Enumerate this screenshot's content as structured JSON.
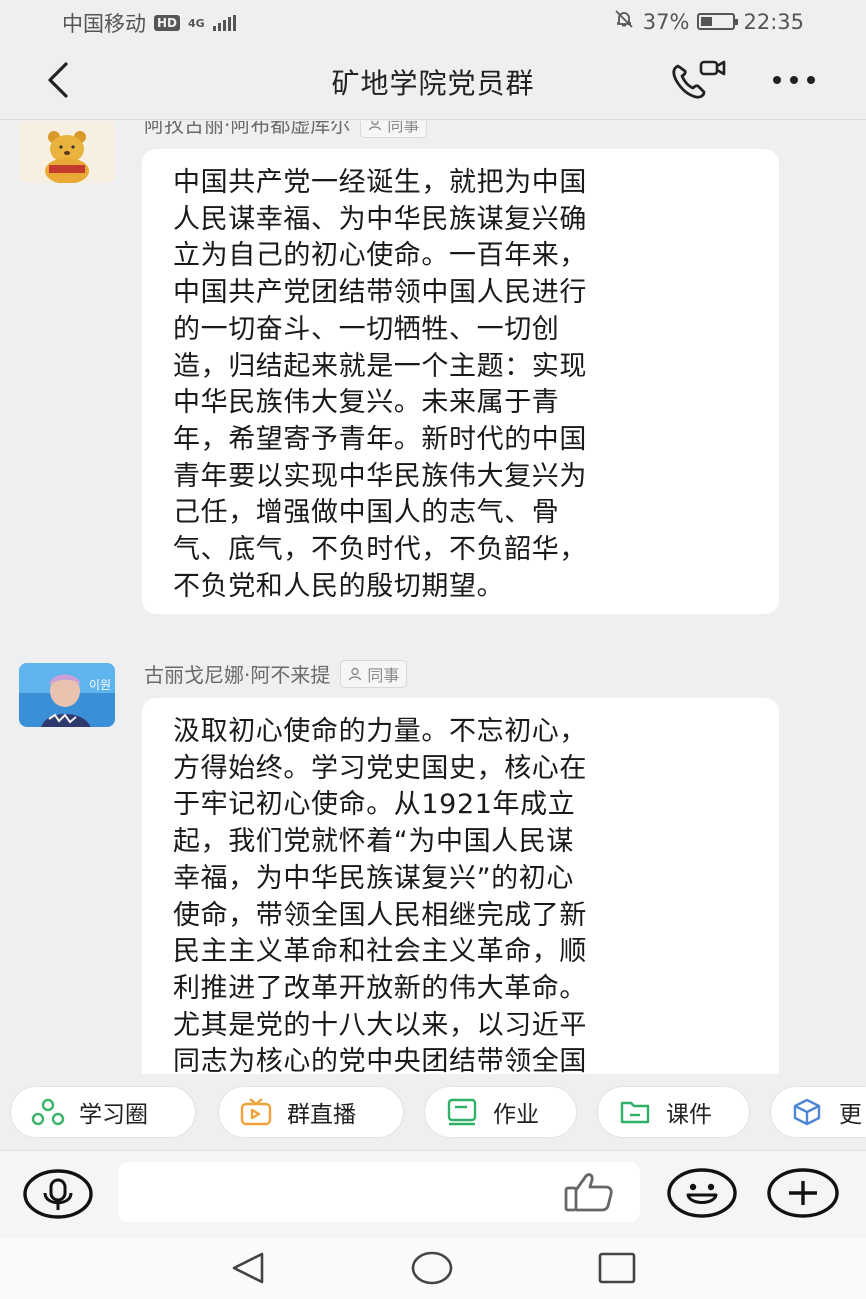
{
  "status_bar": {
    "carrier": "中国移动",
    "hd": "HD",
    "network": "4G",
    "battery": "37%",
    "battery_level": 0.37,
    "time": "22:35"
  },
  "header": {
    "title": "矿地学院党员群",
    "icons": {
      "back": "chevron-left-icon",
      "call": "phone-video-icon",
      "more": "more-dots-icon"
    }
  },
  "messages": [
    {
      "sender": "阿孜古丽·阿布都虚库尔",
      "tag": "同事",
      "lines": [
        "中国共产党一经诞生，就把为中国",
        "人民谋幸福、为中华民族谋复兴确",
        "立为自己的初心使命。一百年来，",
        "中国共产党团结带领中国人民进行",
        "的一切奋斗、一切牺牲、一切创",
        "造，归结起来就是一个主题：实现",
        "中华民族伟大复兴。未来属于青",
        "年，希望寄予青年。新时代的中国",
        "青年要以实现中华民族伟大复兴为",
        "己任，增强做中国人的志气、骨",
        "气、底气，不负时代，不负韶华，",
        "不负党和人民的殷切期望。"
      ]
    },
    {
      "sender": "古丽戈尼娜·阿不来提",
      "tag": "同事",
      "lines": [
        "汲取初心使命的力量。不忘初心，",
        "方得始终。学习党史国史，核心在",
        "于牢记初心使命。从1921年成立",
        "起，我们党就怀着“为中国人民谋",
        "幸福，为中华民族谋复兴”的初心",
        "使命，带领全国人民相继完成了新",
        "民主主义革命和社会主义革命，顺",
        "利推进了改革开放新的伟大革命。",
        "尤其是党的十八大以来，以习近平",
        "同志为核心的党中央团结带领全国"
      ]
    }
  ],
  "quick_actions": [
    {
      "label": "学习圈",
      "icon": "community-icon",
      "color": "#3bb36a"
    },
    {
      "label": "群直播",
      "icon": "tv-live-icon",
      "color": "#f2a23a"
    },
    {
      "label": "作业",
      "icon": "homework-icon",
      "color": "#2fb064"
    },
    {
      "label": "课件",
      "icon": "folder-icon",
      "color": "#2fb064"
    },
    {
      "label": "更",
      "icon": "cube-icon",
      "color": "#4f87d6"
    }
  ],
  "input_bar": {
    "placeholder": "",
    "icons": {
      "voice": "microphone-icon",
      "like": "thumbs-up-icon",
      "emoji": "smiley-icon",
      "plus": "plus-icon"
    }
  },
  "nav_bar": {
    "icons": [
      "triangle-back-icon",
      "circle-home-icon",
      "square-recent-icon"
    ]
  }
}
